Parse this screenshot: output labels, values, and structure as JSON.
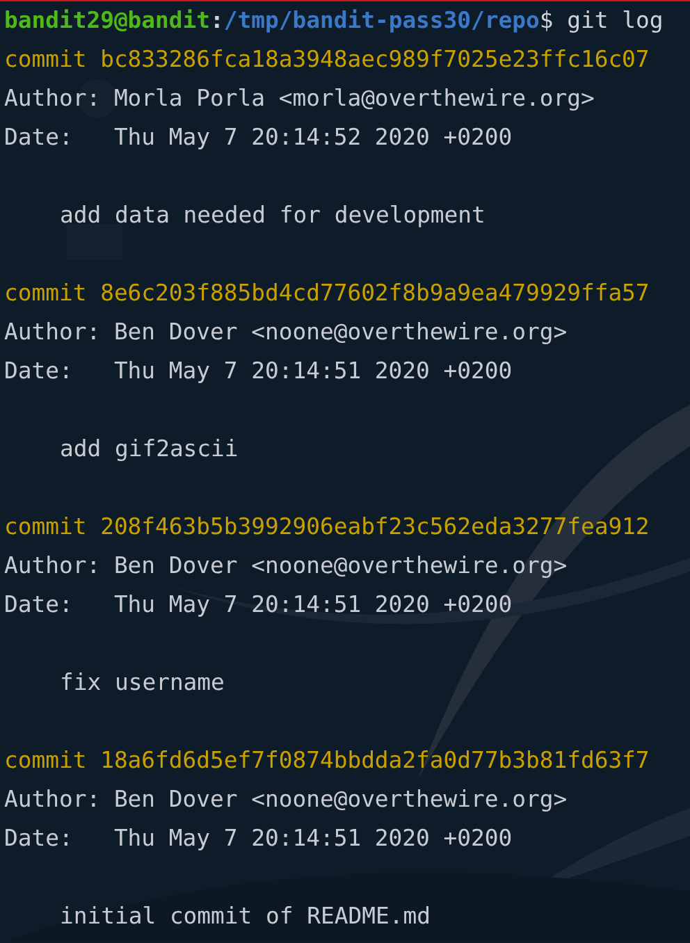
{
  "prompt": {
    "user_host": "bandit29@bandit",
    "separator": ":",
    "path": "/tmp/bandit-pass30/repo",
    "command": "$ git log"
  },
  "commits": [
    {
      "commit": "commit bc833286fca18a3948aec989f7025e23ffc16c07",
      "author": "Author: Morla Porla <morla@overthewire.org>",
      "date": "Date:   Thu May 7 20:14:52 2020 +0200",
      "message": "add data needed for development"
    },
    {
      "commit": "commit 8e6c203f885bd4cd77602f8b9a9ea479929ffa57",
      "author": "Author: Ben Dover <noone@overthewire.org>",
      "date": "Date:   Thu May 7 20:14:51 2020 +0200",
      "message": "add gif2ascii"
    },
    {
      "commit": "commit 208f463b5b3992906eabf23c562eda3277fea912",
      "author": "Author: Ben Dover <noone@overthewire.org>",
      "date": "Date:   Thu May 7 20:14:51 2020 +0200",
      "message": "fix username"
    },
    {
      "commit": "commit 18a6fd6d5ef7f0874bbdda2fa0d77b3b81fd63f7",
      "author": "Author: Ben Dover <noone@overthewire.org>",
      "date": "Date:   Thu May 7 20:14:51 2020 +0200",
      "message": "initial commit of README.md"
    }
  ]
}
